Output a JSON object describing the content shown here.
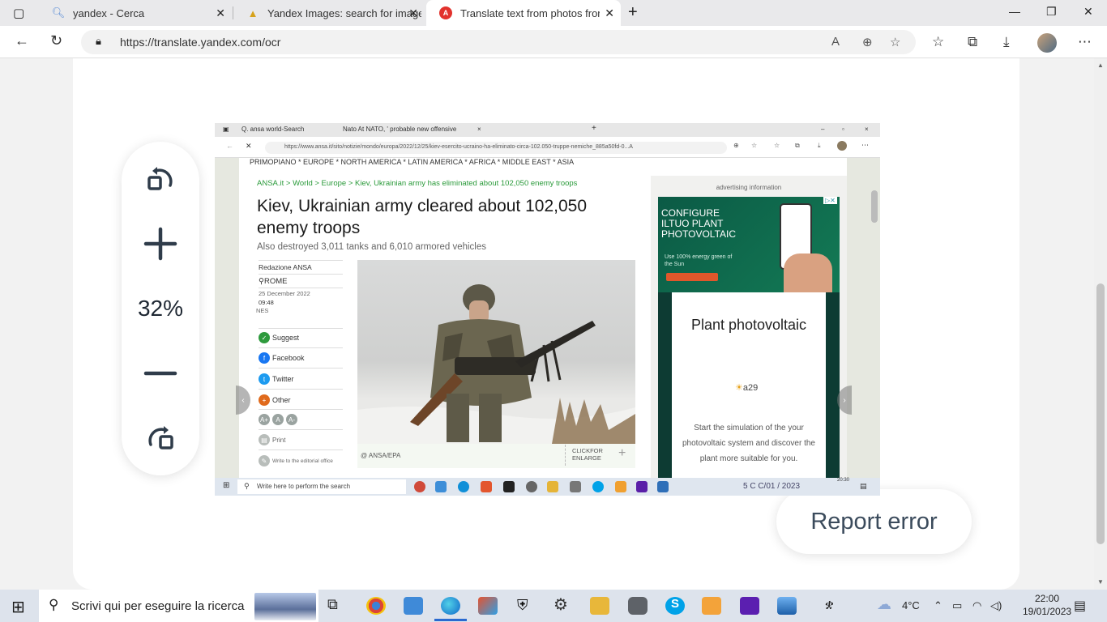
{
  "browser": {
    "tabs": [
      {
        "label": "yandex - Cerca",
        "icon": "search-icon"
      },
      {
        "label": "Yandex Images: search for image",
        "icon": "images-icon"
      },
      {
        "label": "Translate text from photos from Eng",
        "icon": "yandex-translate-icon"
      }
    ],
    "url": "https://translate.yandex.com/ocr"
  },
  "tools": {
    "zoom": "32%"
  },
  "report_error": "Report error",
  "inner": {
    "tabs": [
      "Q. ansa world-Search",
      "Nato At NATO, ' probable new offensive"
    ],
    "url": "https://www.ansa.it/sito/notizie/mondo/europa/2022/12/25/kiev-esercito-ucraino-ha-eliminato-circa-102.050-truppe-nemiche_885a50fd-0...A",
    "menu": "PRIMOPIANO * EUROPE * NORTH AMERICA * LATIN AMERICA * AFRICA * MIDDLE EAST * ASIA",
    "breadcrumb": "ANSA.it > World > Europe > Kiev, Ukrainian army has eliminated about 102,050 enemy troops",
    "title": "Kiev, Ukrainian army cleared about 102,050 enemy troops",
    "subtitle": "Also destroyed 3,011 tanks and 6,010 armored vehicles",
    "author": "Redazione ANSA",
    "place": "ROME",
    "date": "25 December 2022",
    "time": "09:48",
    "tag": "NES",
    "share": [
      "Suggest",
      "Facebook",
      "Twitter",
      "Other"
    ],
    "print": "Print",
    "write": "Write to the editorial office",
    "font_sizes": [
      "A+",
      "A",
      "A-"
    ],
    "photo_credit": "@ ANSA/EPA",
    "click_enlarge": "CLICKFOR ENLARGE",
    "ad": {
      "label": "advertising information",
      "banner_title": "CONFIGURE ILTUO PLANT PHOTOVOLTAIC",
      "banner_sub": "Use 100% energy green of the Sun",
      "card_title": "Plant photovoltaic",
      "brand": "a29",
      "card_text": "Start the simulation of the your photovoltaic system and discover the plant more suitable for you."
    },
    "taskbar_search": "Write here to perform the search",
    "weather": "5 C C/01 / 2023",
    "clock": "20:30"
  },
  "taskbar": {
    "search_placeholder": "Scrivi qui per eseguire la ricerca",
    "temperature": "4°C",
    "time": "22:00",
    "date": "19/01/2023"
  }
}
